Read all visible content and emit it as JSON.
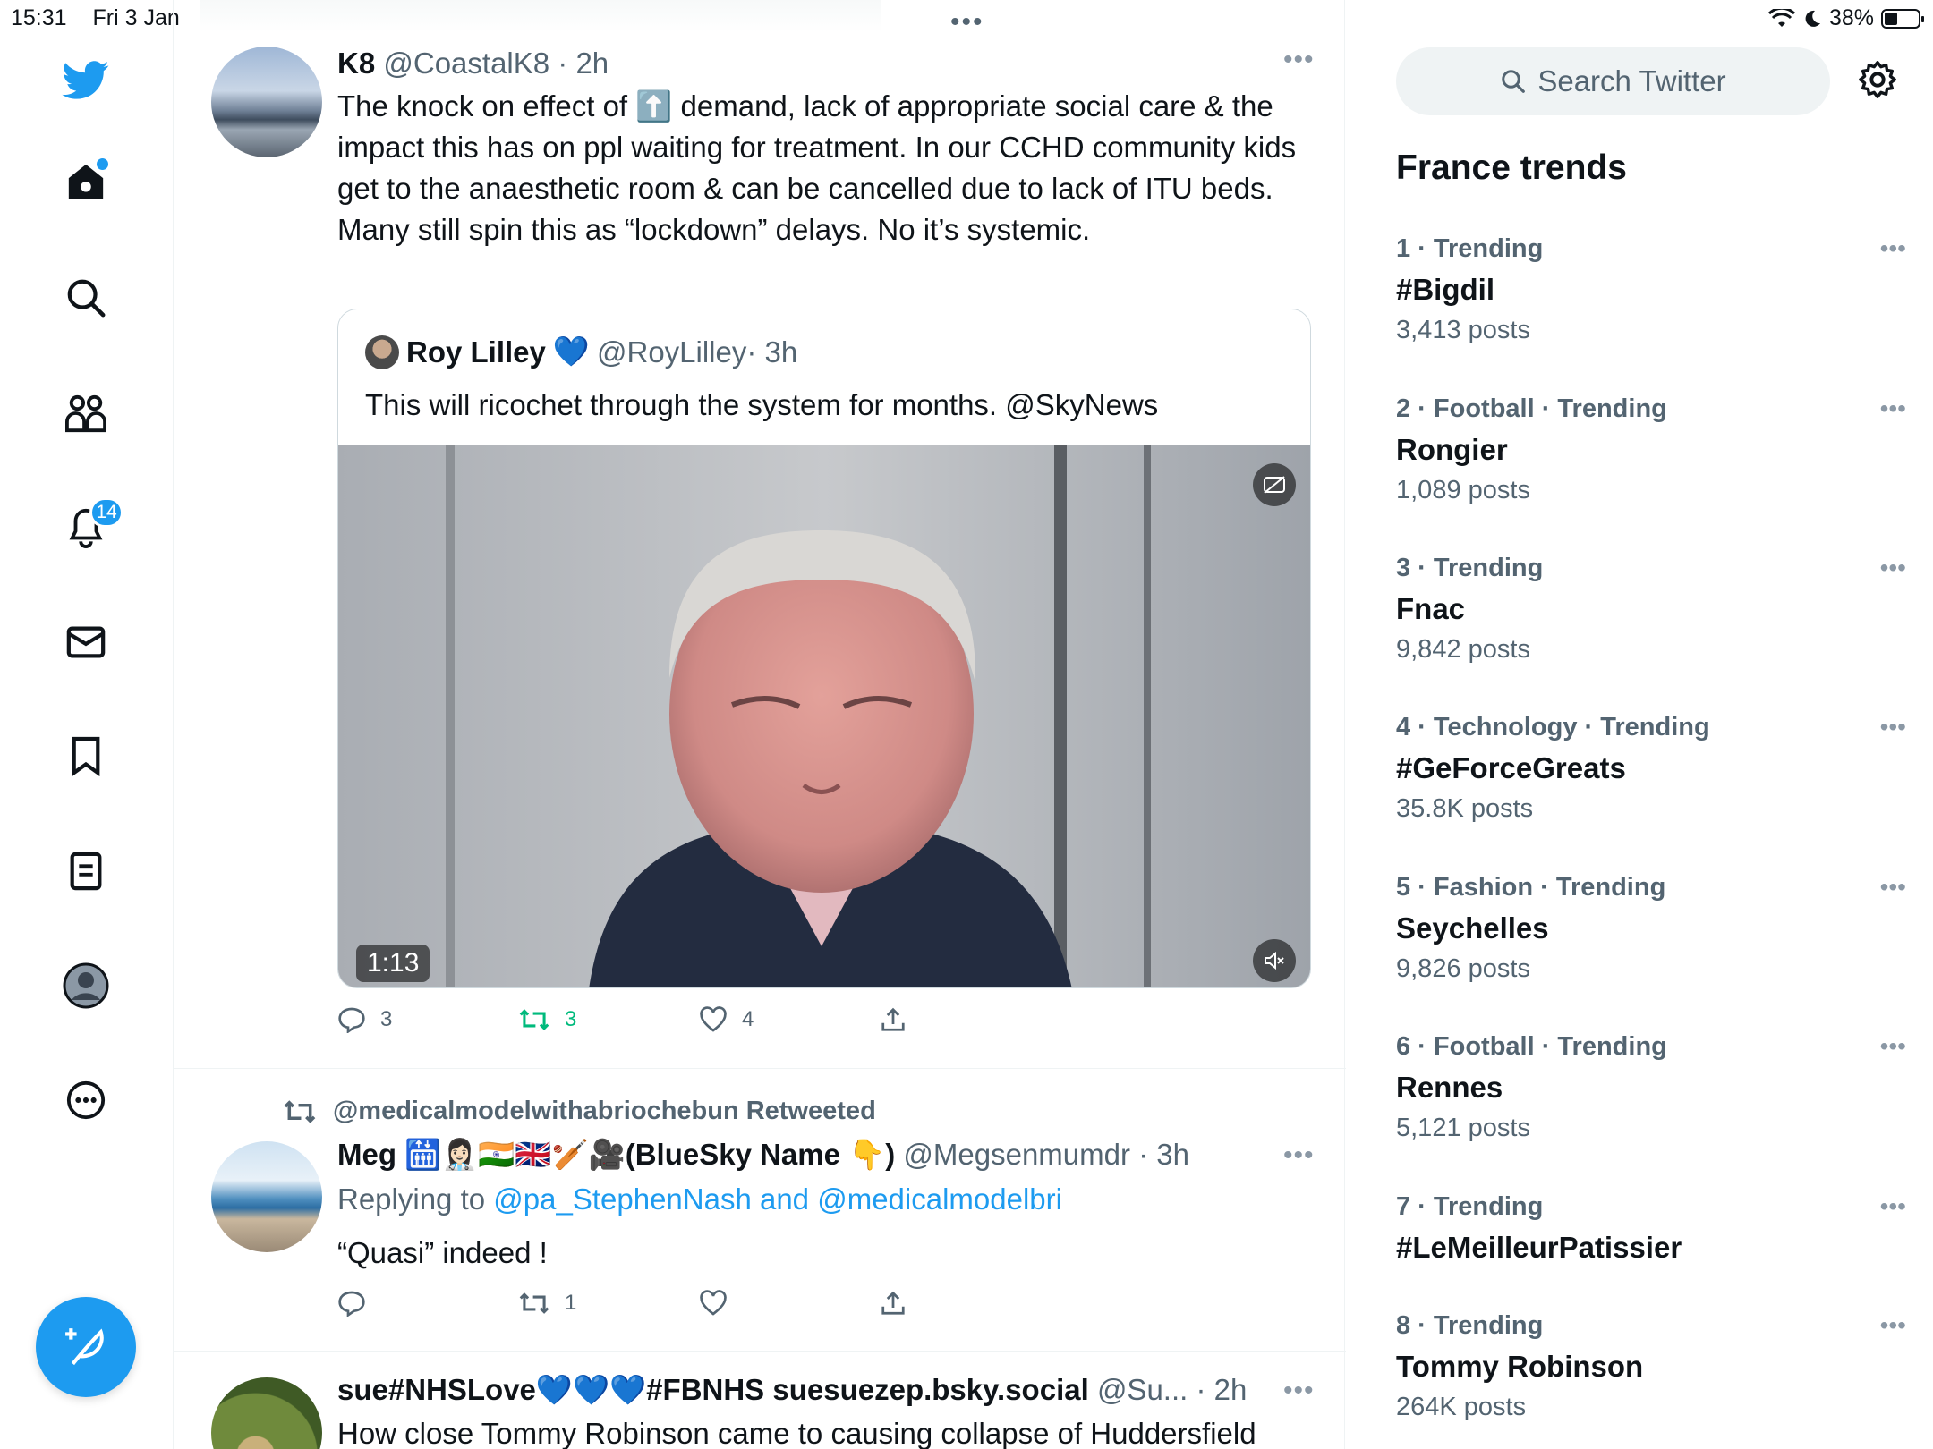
{
  "status_bar": {
    "time": "15:31",
    "date": "Fri 3 Jan",
    "battery": "38%",
    "battery_level": 0.38
  },
  "nav": {
    "notifications_badge": "14"
  },
  "colors": {
    "accent": "#1d9bf0",
    "retweet": "#00ba7c",
    "text": "#0f1419",
    "secondary": "#536471"
  },
  "tweets": [
    {
      "name": "K8",
      "handle": "@CoastalK8",
      "time": " · 2h",
      "text_before": "The knock on effect of ",
      "text_emoji": "⬆️",
      "text_after": " demand, lack of appropriate social care & the impact this has on ppl waiting for treatment. In our CCHD community kids get to the anaesthetic room & can be cancelled due to lack of ITU beds. Many still spin this as “lockdown” delays. No it’s systemic.",
      "quote": {
        "name": "Roy Lilley",
        "emoji": "💙",
        "handle": "@RoyLilley",
        "time": " · 3h",
        "text": "This will ricochet through the system for months. @SkyNews",
        "video_duration": "1:13"
      },
      "replies": "3",
      "retweets": "3",
      "likes": "4"
    },
    {
      "retweeted_by": "@medicalmodelwithabriochebun Retweeted",
      "name": "Meg 🛗👩🏻‍⚕️🇮🇳🇬🇧🏏🎥(BlueSky Name 👇)",
      "handle": "@Megsenmumdr",
      "time": " · 3h",
      "replying_label": "Replying to ",
      "replying_to": "@pa_StephenNash and @medicalmodelbri",
      "text": "“Quasi” indeed !",
      "replies": "",
      "retweets": "1",
      "likes": ""
    },
    {
      "name": "sue#NHSLove💙💙💙#FBNHS suesuezep.bsky.social",
      "handle": "@Su...",
      "time": " · 2h",
      "text": "How close Tommy Robinson came to causing collapse of Huddersfield"
    }
  ],
  "sidebar": {
    "search_placeholder": "Search Twitter",
    "trends_title": "France trends",
    "trends": [
      {
        "meta": "1 · Trending",
        "name": "#Bigdil",
        "count": "3,413 posts"
      },
      {
        "meta": "2 · Football · Trending",
        "name": "Rongier",
        "count": "1,089 posts"
      },
      {
        "meta": "3 · Trending",
        "name": "Fnac",
        "count": "9,842 posts"
      },
      {
        "meta": "4 · Technology · Trending",
        "name": "#GeForceGreats",
        "count": "35.8K posts"
      },
      {
        "meta": "5 · Fashion · Trending",
        "name": "Seychelles",
        "count": "9,826 posts"
      },
      {
        "meta": "6 · Football · Trending",
        "name": "Rennes",
        "count": "5,121 posts"
      },
      {
        "meta": "7 · Trending",
        "name": "#LeMeilleurPatissier",
        "count": ""
      },
      {
        "meta": "8 · Trending",
        "name": "Tommy Robinson",
        "count": "264K posts"
      }
    ]
  }
}
